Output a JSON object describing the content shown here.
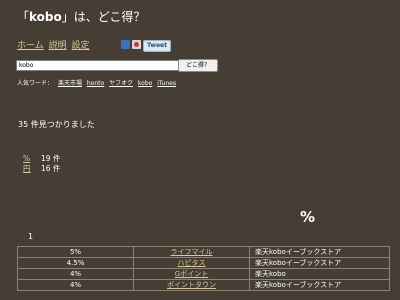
{
  "title": {
    "open_bracket": "「",
    "keyword": "kobo",
    "suffix": "」は、どこ得？"
  },
  "nav": {
    "home": "ホーム",
    "help": "説明",
    "settings": "設定"
  },
  "share": {
    "tweet_label": "Tweet"
  },
  "search": {
    "value": "kobo",
    "button_label": "どこ得？"
  },
  "popular": {
    "label": "人気ワード：",
    "words": [
      "楽天市場",
      "honto",
      "ヤフオク",
      "kobo",
      "iTunes"
    ]
  },
  "result_text": "35 件見つかりました",
  "counts": [
    {
      "key": "%",
      "value": "19 件"
    },
    {
      "key": "円",
      "value": "16 件"
    }
  ],
  "percent_heading": "%",
  "page_number": "1",
  "rows": [
    {
      "rate": "5%",
      "site": "ライフマイル",
      "shop": "楽天koboイーブックストア"
    },
    {
      "rate": "4.5%",
      "site": "ハピタス",
      "shop": "楽天koboイーブックストア"
    },
    {
      "rate": "4%",
      "site": "Gポイント",
      "shop": "楽天kobo"
    },
    {
      "rate": "4%",
      "site": "ポイントタウン",
      "shop": "楽天koboイーブックストア"
    }
  ]
}
